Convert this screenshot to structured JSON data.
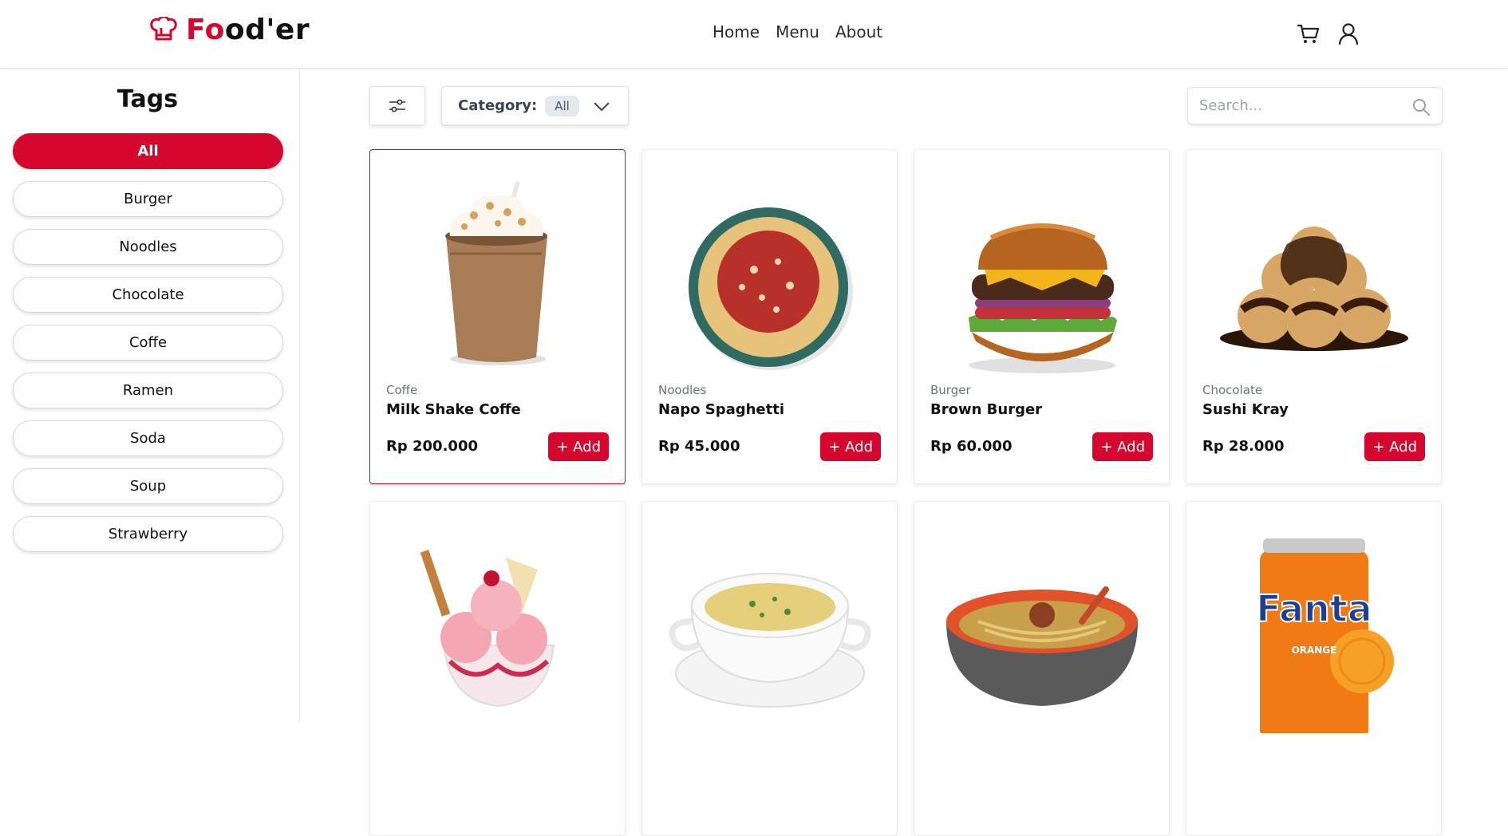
{
  "brand": {
    "logo_red": "Fo",
    "logo_dark": "od'er",
    "accent": "#d6072e",
    "logo_icon": "chef-hat-icon"
  },
  "nav": {
    "items": [
      {
        "label": "Home"
      },
      {
        "label": "Menu"
      },
      {
        "label": "About"
      }
    ]
  },
  "header_icons": {
    "cart": "cart-icon",
    "user": "user-icon"
  },
  "sidebar": {
    "title": "Tags",
    "tags": [
      {
        "label": "All",
        "active": true
      },
      {
        "label": "Burger"
      },
      {
        "label": "Noodles"
      },
      {
        "label": "Chocolate"
      },
      {
        "label": "Coffe"
      },
      {
        "label": "Ramen"
      },
      {
        "label": "Soda"
      },
      {
        "label": "Soup"
      },
      {
        "label": "Strawberry"
      }
    ]
  },
  "toolbar": {
    "filter_icon": "sliders-icon",
    "category_label": "Category:",
    "category_value": "All",
    "search_placeholder": "Search..."
  },
  "products": [
    {
      "category": "Coffe",
      "name": "Milk Shake Coffe",
      "price": "Rp 200.000",
      "add_label": "+ Add",
      "image": "milkshake-image",
      "selected": true
    },
    {
      "category": "Noodles",
      "name": "Napo Spaghetti",
      "price": "Rp 45.000",
      "add_label": "+ Add",
      "image": "spaghetti-image"
    },
    {
      "category": "Burger",
      "name": "Brown Burger",
      "price": "Rp 60.000",
      "add_label": "+ Add",
      "image": "burger-image"
    },
    {
      "category": "Chocolate",
      "name": "Sushi Kray",
      "price": "Rp 28.000",
      "add_label": "+ Add",
      "image": "chocolate-puffs-image"
    },
    {
      "image": "ice-cream-sundae-image"
    },
    {
      "image": "soup-bowl-image"
    },
    {
      "image": "ramen-bowl-image"
    },
    {
      "image": "fanta-can-image",
      "can_brand": "Fanta",
      "can_text": "ORANGE"
    }
  ]
}
